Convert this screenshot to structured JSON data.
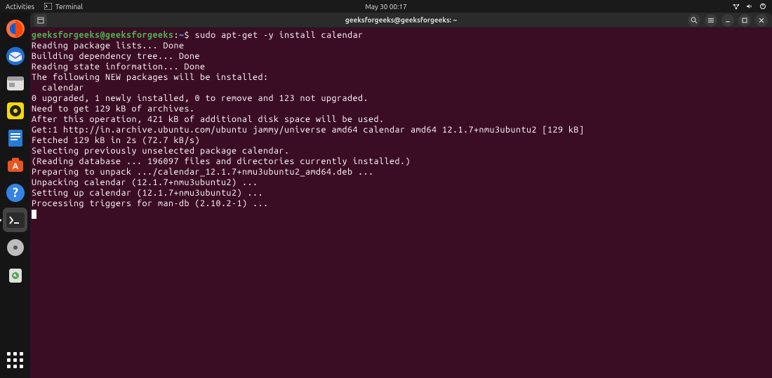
{
  "top_panel": {
    "activities": "Activities",
    "app_label": "Terminal",
    "clock": "May 30  00:17"
  },
  "titlebar": {
    "title": "geeksforgeeks@geeksforgeeks: ~"
  },
  "prompt": {
    "userhost": "geeksforgeeks@geeksforgeeks",
    "sep": ":",
    "path": "~",
    "dollar": "$",
    "command": "sudo apt-get -y install calendar"
  },
  "output": [
    "Reading package lists... Done",
    "Building dependency tree... Done",
    "Reading state information... Done",
    "The following NEW packages will be installed:",
    "  calendar",
    "0 upgraded, 1 newly installed, 0 to remove and 123 not upgraded.",
    "Need to get 129 kB of archives.",
    "After this operation, 421 kB of additional disk space will be used.",
    "Get:1 http://in.archive.ubuntu.com/ubuntu jammy/universe amd64 calendar amd64 12.1.7+nmu3ubuntu2 [129 kB]",
    "Fetched 129 kB in 2s (72.7 kB/s)",
    "Selecting previously unselected package calendar.",
    "(Reading database ... 196097 files and directories currently installed.)",
    "Preparing to unpack .../calendar_12.1.7+nmu3ubuntu2_amd64.deb ...",
    "Unpacking calendar (12.1.7+nmu3ubuntu2) ...",
    "Setting up calendar (12.1.7+nmu3ubuntu2) ...",
    "Processing triggers for man-db (2.10.2-1) ..."
  ]
}
